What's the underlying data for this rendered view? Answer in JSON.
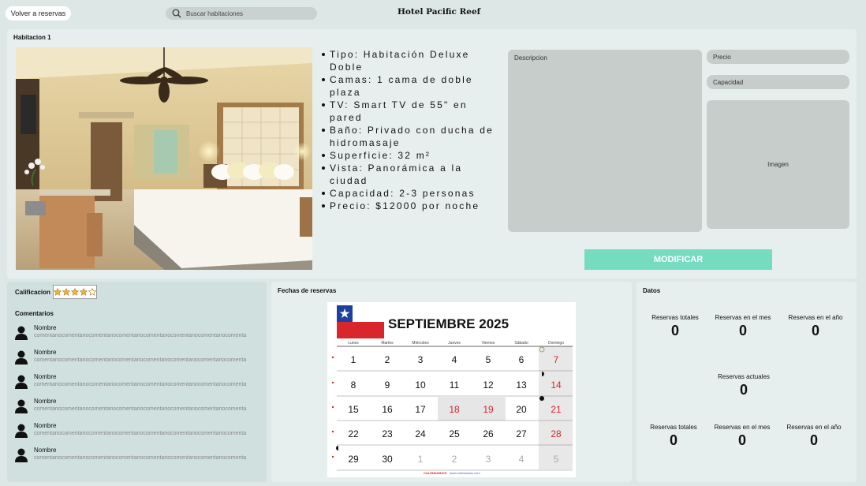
{
  "header": {
    "back_label": "Volver a reservas",
    "search_placeholder": "Buscar habitaciones",
    "brand": "Hotel Pacific Reef"
  },
  "room": {
    "title": "Habitacion 1",
    "features": [
      "Tipo: Habitación Deluxe Doble",
      "Camas: 1 cama de doble plaza",
      "TV: Smart TV de 55\" en pared",
      "Baño: Privado con ducha de hidromasaje",
      "Superficie: 32 m²",
      "Vista: Panorámica a la ciudad",
      "Capacidad: 2-3 personas",
      "Precio: $12000 por noche"
    ],
    "form": {
      "description_label": "Descripcion",
      "price_label": "Precio",
      "capacity_label": "Capacidad",
      "image_label": "Imagen",
      "modify_label": "MODIFICAR"
    }
  },
  "rating": {
    "title": "Calificacion",
    "stars_filled": 4,
    "stars_total": 5,
    "comments_title": "Comentarios",
    "comments": [
      {
        "name": "Nombre",
        "text": "comentariocomentariocomentariocomentariocomentariocomentariocomentariocomenta"
      },
      {
        "name": "Nombre",
        "text": "comentariocomentariocomentariocomentariocomentariocomentariocomentariocomenta"
      },
      {
        "name": "Nombre",
        "text": "comentariocomentariocomentariocomentariocomentariocomentariocomentariocomenta"
      },
      {
        "name": "Nombre",
        "text": "comentariocomentariocomentariocomentariocomentariocomentariocomentariocomenta"
      },
      {
        "name": "Nombre",
        "text": "comentariocomentariocomentariocomentariocomentariocomentariocomentariocomenta"
      },
      {
        "name": "Nombre",
        "text": "comentariocomentariocomentariocomentariocomentariocomentariocomentariocomenta"
      }
    ]
  },
  "calendar": {
    "title": "Fechas de reservas",
    "month_label": "SEPTIEMBRE 2025",
    "weekdays": [
      "Lunes",
      "Martes",
      "Miércoles",
      "Jueves",
      "Viernes",
      "Sábado",
      "Domingo"
    ],
    "weeks": [
      [
        "1",
        "2",
        "3",
        "4",
        "5",
        "6",
        "7"
      ],
      [
        "8",
        "9",
        "10",
        "11",
        "12",
        "13",
        "14"
      ],
      [
        "15",
        "16",
        "17",
        "18",
        "19",
        "20",
        "21"
      ],
      [
        "22",
        "23",
        "24",
        "25",
        "26",
        "27",
        "28"
      ],
      [
        "29",
        "30",
        "1",
        "2",
        "3",
        "4",
        "5"
      ]
    ],
    "holidays": [
      "18",
      "19"
    ],
    "footer_brand": "CALENDARIOS",
    "footer_link": "www.calendarios.com",
    "colors": {
      "red": "#d9262c",
      "flag_blue": "#1f3fa0"
    }
  },
  "stats": {
    "title": "Datos",
    "row1": [
      {
        "label": "Reservas totales",
        "value": "0"
      },
      {
        "label": "Reservas en el mes",
        "value": "0"
      },
      {
        "label": "Reservas en el año",
        "value": "0"
      }
    ],
    "current": {
      "label": "Reservas actuales",
      "value": "0"
    },
    "row2": [
      {
        "label": "Reservas totales",
        "value": "0"
      },
      {
        "label": "Reservas en el mes",
        "value": "0"
      },
      {
        "label": "Reservas en el año",
        "value": "0"
      }
    ]
  }
}
